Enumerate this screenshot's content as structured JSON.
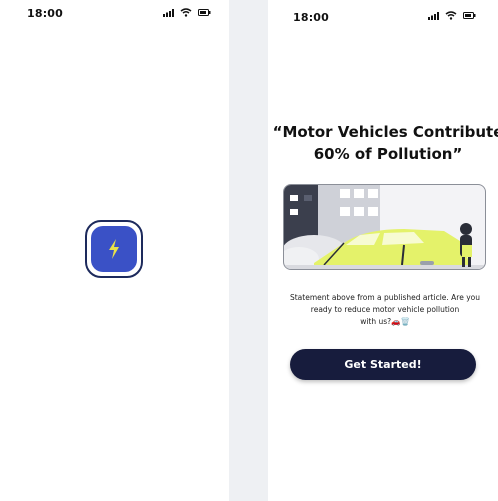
{
  "splash": {
    "status_time": "18:00",
    "logo_icon": "lightning-bolt-icon"
  },
  "onboarding": {
    "status_time": "18:00",
    "headline_line1": "“Motor Vehicles Contribute",
    "headline_line2": "60% of Pollution”",
    "body_line1": "Statement above from a published article. Are you",
    "body_line2": "ready to reduce motor vehicle pollution",
    "body_line3": "with us?🚗🗑️",
    "cta_label": "Get Started!"
  },
  "colors": {
    "logo_blue": "#3a51c6",
    "logo_border": "#1d2a5c",
    "bolt_yellow": "#e8e24a",
    "cta_navy": "#171c3d",
    "car_lime": "#e4f26a"
  }
}
